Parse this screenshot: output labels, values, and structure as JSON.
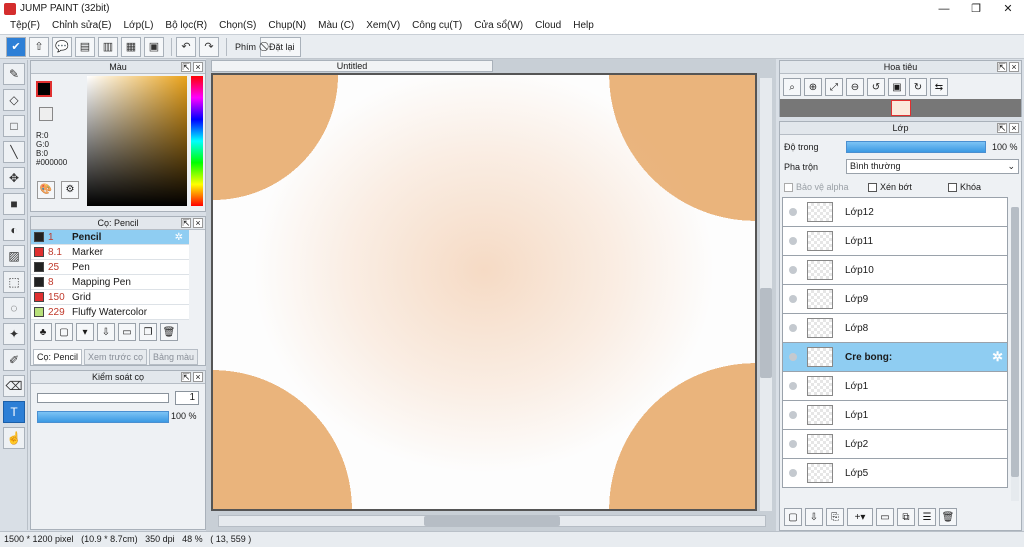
{
  "window": {
    "title": "JUMP PAINT (32bit)",
    "min": "—",
    "max": "❐",
    "close": "✕"
  },
  "menu": [
    "Tệp(F)",
    "Chỉnh sửa(E)",
    "Lớp(L)",
    "Bộ lọc(R)",
    "Chọn(S)",
    "Chụp(N)",
    "Màu (C)",
    "Xem(V)",
    "Công cụ(T)",
    "Cửa sổ(W)",
    "Cloud",
    "Help"
  ],
  "toolbar": {
    "phim_label": "Phím",
    "reset_label": "Đặt lại"
  },
  "color_panel": {
    "title": "Màu",
    "r": "R:0",
    "g": "G:0",
    "b": "B:0",
    "hex": "#000000"
  },
  "brush_panel": {
    "title": "Cọ: Pencil",
    "brushes": [
      {
        "size": "1",
        "name": "Pencil",
        "color": "#222222"
      },
      {
        "size": "8.1",
        "name": "Marker",
        "color": "#e03030"
      },
      {
        "size": "25",
        "name": "Pen",
        "color": "#222222"
      },
      {
        "size": "8",
        "name": "Mapping Pen",
        "color": "#222222"
      },
      {
        "size": "150",
        "name": "Grid",
        "color": "#e03030"
      },
      {
        "size": "229",
        "name": "Fluffy Watercolor",
        "color": "#b8e07a"
      }
    ],
    "tabs": [
      "Cọ: Pencil",
      "Xem trước cọ",
      "Bảng màu"
    ]
  },
  "brush_control": {
    "title": "Kiểm soát cọ",
    "size_value": "1",
    "opacity_value": "100 %"
  },
  "document": {
    "tab": "Untitled"
  },
  "navigator": {
    "title": "Hoa tiêu"
  },
  "layers_panel": {
    "title": "Lớp",
    "opacity_label": "Độ trong",
    "opacity_value": "100 %",
    "blend_label": "Pha trộn",
    "blend_value": "Bình thường",
    "protect_alpha": "Bảo vệ alpha",
    "clip": "Xén bớt",
    "lock": "Khóa",
    "layers": [
      "Lớp12",
      "Lớp11",
      "Lớp10",
      "Lớp9",
      "Lớp8",
      "Cre bong:",
      "Lớp1",
      "Lớp1",
      "Lớp2",
      "Lớp5"
    ],
    "selected_index": 5
  },
  "status": {
    "size": "1500 * 1200 pixel",
    "cm": "(10.9 * 8.7cm)",
    "dpi": "350 dpi",
    "zoom": "48 %",
    "coords": "( 13, 559 )"
  },
  "colors": {
    "accent": "#2d7fd6",
    "selection": "#8fcdf2"
  }
}
